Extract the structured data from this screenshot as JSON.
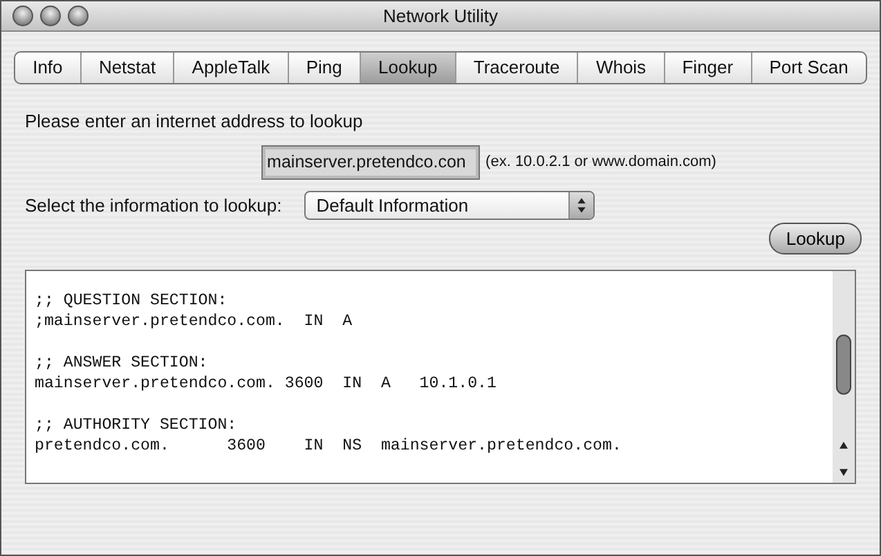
{
  "window": {
    "title": "Network Utility"
  },
  "tabs": [
    {
      "label": "Info",
      "selected": false
    },
    {
      "label": "Netstat",
      "selected": false
    },
    {
      "label": "AppleTalk",
      "selected": false
    },
    {
      "label": "Ping",
      "selected": false
    },
    {
      "label": "Lookup",
      "selected": true
    },
    {
      "label": "Traceroute",
      "selected": false
    },
    {
      "label": "Whois",
      "selected": false
    },
    {
      "label": "Finger",
      "selected": false
    },
    {
      "label": "Port Scan",
      "selected": false
    }
  ],
  "address_prompt": "Please enter an internet address to lookup",
  "address_field": {
    "value": "mainserver.pretendco.con",
    "hint": "(ex. 10.0.2.1 or www.domain.com)"
  },
  "info_prompt": "Select the information to lookup:",
  "info_select": {
    "value": "Default Information"
  },
  "lookup_button": "Lookup",
  "output": {
    "sections": [
      {
        "lines": [
          ";; QUESTION SECTION:",
          ";mainserver.pretendco.com.  IN  A"
        ]
      },
      {
        "lines": [
          ";; ANSWER SECTION:",
          "mainserver.pretendco.com. 3600  IN  A   10.1.0.1"
        ]
      },
      {
        "lines": [
          ";; AUTHORITY SECTION:",
          "pretendco.com.      3600    IN  NS  mainserver.pretendco.com."
        ]
      }
    ]
  }
}
